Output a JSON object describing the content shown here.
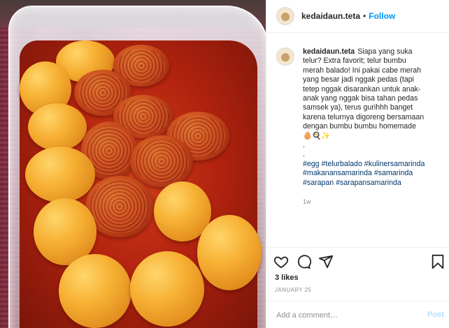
{
  "post_image": {
    "alt_subject": "telur balado"
  },
  "header": {
    "username": "kedaidaun.teta",
    "separator": "•",
    "follow_label": "Follow"
  },
  "caption": {
    "username": "kedaidaun.teta",
    "text_lines": [
      "Siapa yang suka",
      "telur? Extra favorit; telur bumbu",
      "merah balado! Ini pakai cabe merah",
      "yang besar jadi nggak pedas (tapi",
      "tetep nggak disarankan untuk anak-",
      "anak yang nggak bisa tahan pedas",
      "samsek ya), terus gurihhh banget",
      "karena telurnya digoreng bersamaan",
      "dengan bumbu bumbu homemade"
    ],
    "emoji_line": "🥚🍳✨",
    "dot_lines": [
      ".",
      "."
    ],
    "hashtags": [
      "#egg",
      "#telurbalado",
      "#kulinersamarinda",
      "#makanansamarinda",
      "#samarinda",
      "#sarapan",
      "#sarapansamarinda"
    ],
    "age": "1w"
  },
  "actions": {
    "like_icon": "heart-icon",
    "comment_icon": "comment-icon",
    "share_icon": "paper-plane-icon",
    "save_icon": "bookmark-icon"
  },
  "likes": "3 likes",
  "date": "JANUARY 25",
  "comment": {
    "placeholder": "Add a comment…",
    "post_label": "Post"
  },
  "colors": {
    "link_blue": "#0095f6",
    "hashtag": "#00376b",
    "post_disabled": "#b2dffc",
    "muted": "#8e8e8e"
  }
}
